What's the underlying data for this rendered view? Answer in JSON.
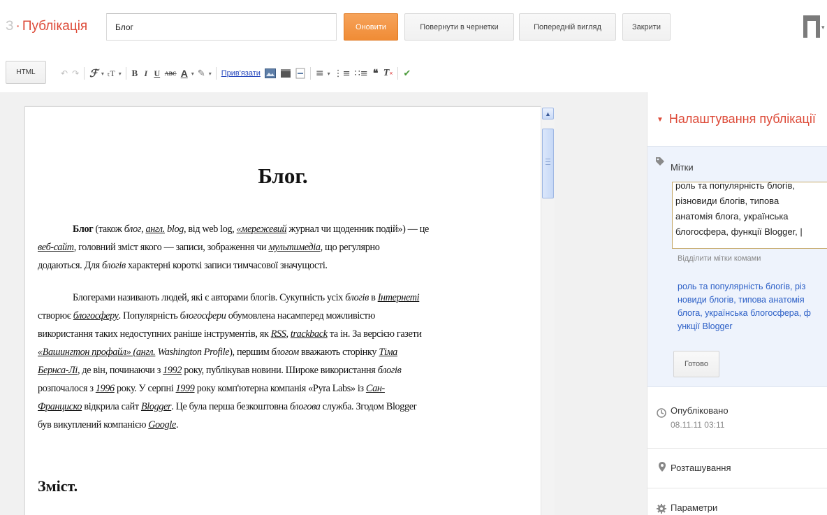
{
  "header": {
    "crumb_prefix": "З",
    "crumb_title": "Публікація",
    "title_value": "Блог",
    "update_button": "Оновити",
    "revert_button": "Повернути в чернетки",
    "preview_button": "Попередній вигляд",
    "close_button": "Закрити"
  },
  "toolbar": {
    "html_button": "HTML",
    "link_label": "Прив'язати",
    "items": [
      "undo-icon",
      "redo-icon",
      "font-family-icon",
      "font-size-icon",
      "bold-icon",
      "italic-icon",
      "underline-icon",
      "strikethrough-icon",
      "text-color-icon",
      "highlight-icon",
      "link",
      "image-icon",
      "video-icon",
      "jump-break-icon",
      "align-icon",
      "numbered-list-icon",
      "bullet-list-icon",
      "quote-icon",
      "remove-format-icon",
      "spellcheck-icon"
    ]
  },
  "document": {
    "title": "Блог.",
    "lines_p1": [
      [
        {
          "t": "Блог",
          "s": "b"
        },
        {
          "t": " (також "
        },
        {
          "t": "блог",
          "s": "i"
        },
        {
          "t": ", "
        },
        {
          "t": "англ.",
          "s": "u"
        },
        {
          "t": " "
        },
        {
          "t": "blog",
          "s": "i"
        },
        {
          "t": ", від web log, "
        },
        {
          "t": "«мережевий",
          "s": "u"
        },
        {
          "t": " журнал чи щоденник подій») — це"
        }
      ],
      [
        {
          "t": "веб-сайт",
          "s": "u"
        },
        {
          "t": ", головний зміст якого — записи, зображення чи "
        },
        {
          "t": "мультимедіа",
          "s": "u"
        },
        {
          "t": ", що регулярно"
        }
      ],
      [
        {
          "t": "додаються. Для "
        },
        {
          "t": "блогів",
          "s": "i"
        },
        {
          "t": " характерні короткі записи тимчасової значущості."
        }
      ]
    ],
    "lines_p2": [
      [
        {
          "t": "Блогерами називають людей, які є авторами блогів. Сукупність усіх "
        },
        {
          "t": "блогів",
          "s": "i"
        },
        {
          "t": " в "
        },
        {
          "t": "Інтернеті",
          "s": "u"
        }
      ],
      [
        {
          "t": "створює "
        },
        {
          "t": "блогосферу",
          "s": "u"
        },
        {
          "t": ". Популярність "
        },
        {
          "t": "блогосфери",
          "s": "i"
        },
        {
          "t": " обумовлена насамперед можливістю"
        }
      ],
      [
        {
          "t": "використання таких недоступних раніше інструментів, як "
        },
        {
          "t": "RSS",
          "s": "u"
        },
        {
          "t": ", "
        },
        {
          "t": "trackback",
          "s": "u"
        },
        {
          "t": " та ін. За версією газети"
        }
      ],
      [
        {
          "t": "«Вашингтон профайл» (англ.",
          "s": "u"
        },
        {
          "t": " "
        },
        {
          "t": "Washington Profile",
          "s": "i"
        },
        {
          "t": "), першим "
        },
        {
          "t": "блогом",
          "s": "i"
        },
        {
          "t": " вважають сторінку "
        },
        {
          "t": "Тіма",
          "s": "u"
        }
      ],
      [
        {
          "t": "Бернса-Лі",
          "s": "u"
        },
        {
          "t": ", де він, починаючи з "
        },
        {
          "t": "1992",
          "s": "u"
        },
        {
          "t": " року, публікував новини. Широке використання "
        },
        {
          "t": "блогів",
          "s": "i"
        }
      ],
      [
        {
          "t": "розпочалося з "
        },
        {
          "t": "1996",
          "s": "u"
        },
        {
          "t": " року. У серпні "
        },
        {
          "t": "1999",
          "s": "u"
        },
        {
          "t": " року комп'ютерна компанія «Pyra Labs» із "
        },
        {
          "t": "Сан-",
          "s": "u"
        }
      ],
      [
        {
          "t": "Франциско",
          "s": "u"
        },
        {
          "t": " відкрила сайт "
        },
        {
          "t": "Blogger",
          "s": "u"
        },
        {
          "t": ". Це була перша безкоштовна "
        },
        {
          "t": "блогова",
          "s": "i"
        },
        {
          "t": " служба. Згодом Blogger"
        }
      ],
      [
        {
          "t": "був викуплений компанією "
        },
        {
          "t": "Google",
          "s": "u"
        },
        {
          "t": "."
        }
      ]
    ],
    "heading2": "Зміст."
  },
  "settings": {
    "title": "Налаштування публікації",
    "labels_head": "Мітки",
    "labels_textarea_lines": [
      "роль та популярність блогів,",
      "різновиди блогів, типова",
      "анатомія блога, українська",
      "блогосфера, функції Blogger, |"
    ],
    "labels_hint": "Відділити мітки комами",
    "labels_suggest_lines": [
      "роль та популярність блогів, різ",
      "новиди блогів, типова анатомія",
      "блога, українська блогосфера, ф",
      "ункції Blogger"
    ],
    "done_button": "Готово",
    "published_head": "Опубліковано",
    "published_value": "08.11.11 03:11",
    "location_head": "Розташування",
    "options_head": "Параметри"
  }
}
